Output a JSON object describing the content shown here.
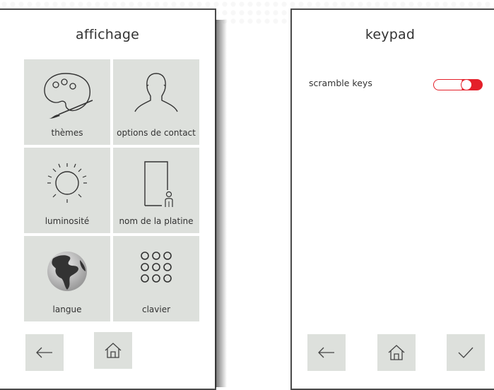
{
  "left_screen": {
    "title": "affichage",
    "tiles": [
      {
        "label": "thèmes",
        "icon": "palette-icon"
      },
      {
        "label": "options de contact",
        "icon": "person-silhouette-icon"
      },
      {
        "label": "luminosité",
        "icon": "sun-icon"
      },
      {
        "label": "nom de la platine",
        "icon": "door-person-icon"
      },
      {
        "label": "langue",
        "icon": "globe-icon"
      },
      {
        "label": "clavier",
        "icon": "keypad-dots-icon"
      }
    ],
    "nav": {
      "back_icon": "arrow-left-icon",
      "home_icon": "home-icon"
    }
  },
  "right_screen": {
    "title": "keypad",
    "setting": {
      "label": "scramble keys",
      "enabled": true
    },
    "nav": {
      "back_icon": "arrow-left-icon",
      "home_icon": "home-icon",
      "confirm_icon": "checkmark-icon"
    }
  },
  "colors": {
    "tile_bg": "#dde0dc",
    "accent": "#e4202a",
    "bezel": "#4a4a4a",
    "text": "#333333"
  }
}
